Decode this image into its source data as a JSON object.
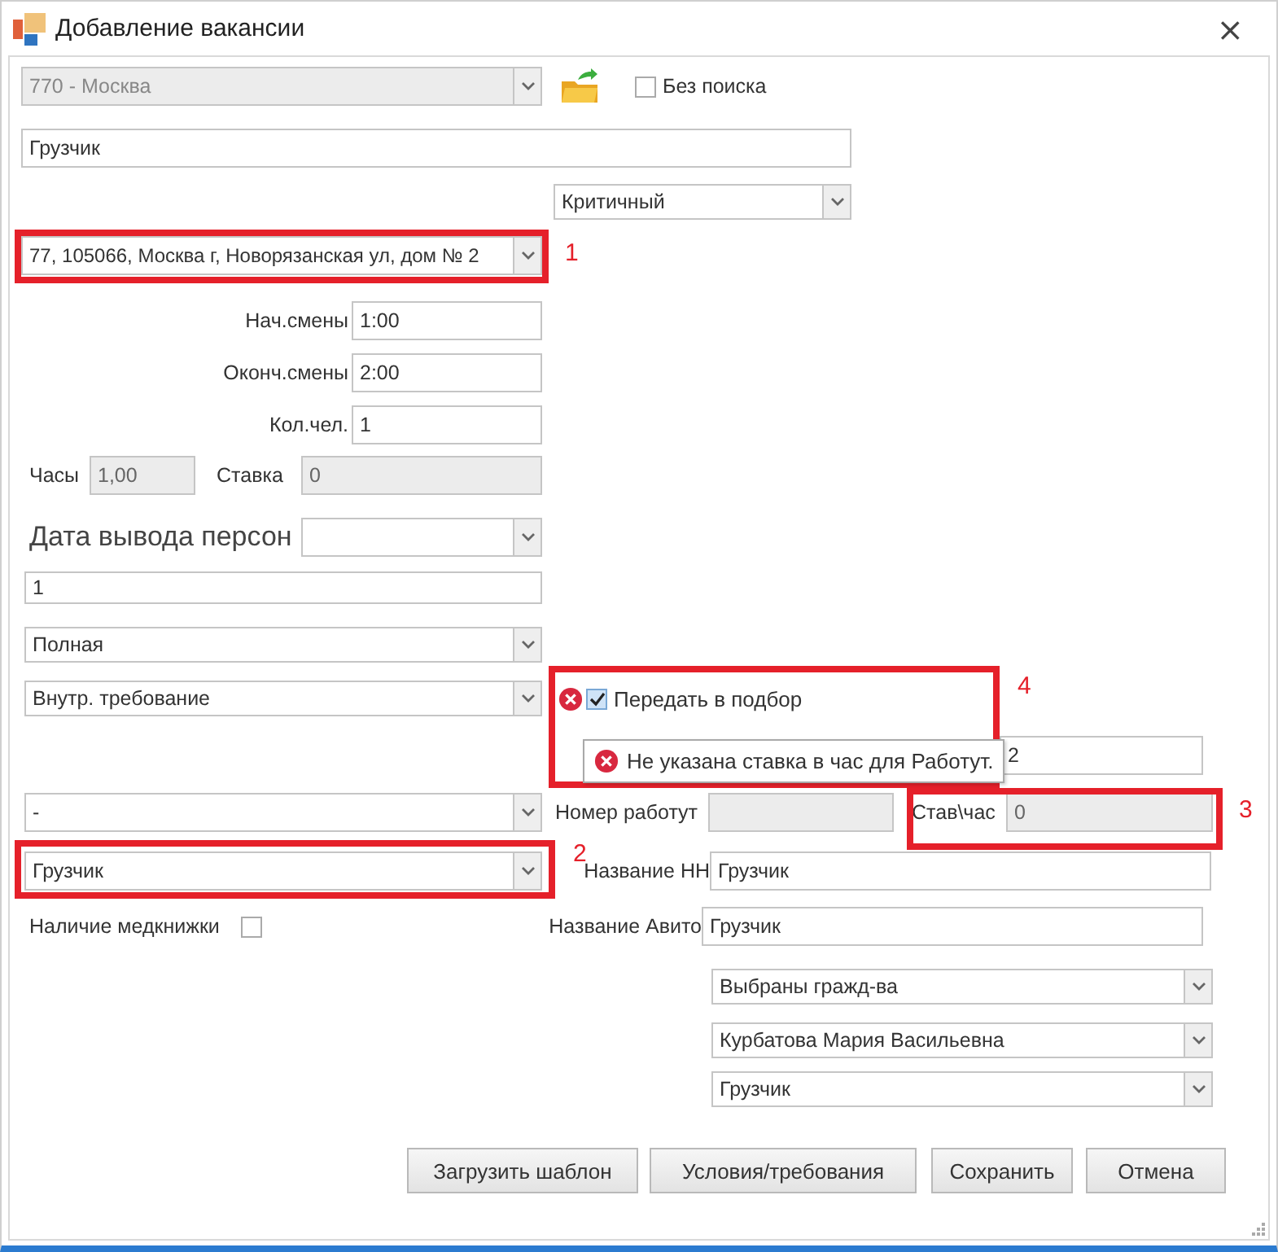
{
  "window": {
    "title": "Добавление вакансии",
    "close": "×"
  },
  "region": {
    "value": "770 - Москва",
    "disabled": true
  },
  "no_search": {
    "label": "Без поиска",
    "checked": false
  },
  "vacancy_name": {
    "value": "Грузчик"
  },
  "priority": {
    "value": "Критичный"
  },
  "address": {
    "value": "77, 105066, Москва г, Новорязанская ул, дом № 2",
    "callout": "1"
  },
  "shift_start": {
    "label": "Нач.смены",
    "value": "1:00"
  },
  "shift_end": {
    "label": "Оконч.смены",
    "value": "2:00"
  },
  "people": {
    "label": "Кол.чел.",
    "value": "1"
  },
  "hours": {
    "label": "Часы",
    "value": "1,00",
    "disabled": true
  },
  "rate": {
    "label": "Ставка",
    "value": "0",
    "disabled": true
  },
  "output_date": {
    "label": "Дата вывода персон"
  },
  "field_1": {
    "value": "1"
  },
  "employment": {
    "value": "Полная"
  },
  "reason": {
    "value": "Внутр. требование"
  },
  "transfer": {
    "label": "Передать в подбор",
    "checked": true,
    "error": true,
    "callout": "4"
  },
  "error_tooltip": {
    "text": "Не указана ставка в час для Работут."
  },
  "field_2": {
    "value": "2"
  },
  "combo_dash": {
    "value": "-"
  },
  "rabotut_number": {
    "label": "Номер работут",
    "disabled": true
  },
  "rate_hour": {
    "label": "Став\\час",
    "value": "0",
    "disabled": true,
    "callout": "3"
  },
  "position": {
    "value": "Грузчик",
    "callout": "2"
  },
  "hh_name": {
    "label": "Название НН",
    "value": "Грузчик"
  },
  "medbook": {
    "label": "Наличие медкнижки",
    "checked": false
  },
  "avito_name": {
    "label": "Название Авито",
    "value": "Грузчик"
  },
  "citizenship": {
    "value": "Выбраны гражд-ва"
  },
  "recruiter": {
    "value": "Курбатова Мария Васильевна"
  },
  "profession": {
    "value": "Грузчик"
  },
  "buttons": [
    "Загрузить шаблон",
    "Условия/требования",
    "Сохранить",
    "Отмена"
  ]
}
